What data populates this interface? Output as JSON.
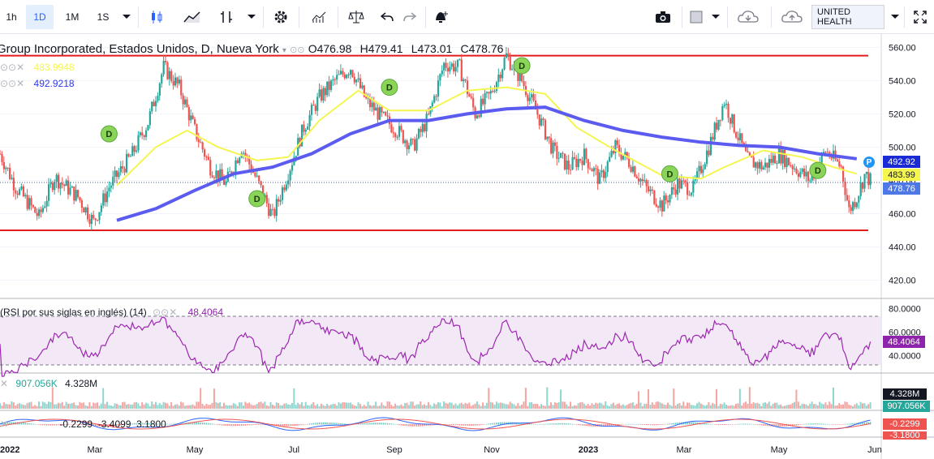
{
  "toolbar": {
    "intervals": [
      "1h",
      "1D",
      "1M",
      "1S"
    ],
    "active_interval": "1D",
    "symbol_search": "UNITED HEALTH",
    "icons": [
      "candles-icon",
      "line-chart-icon",
      "bars-icon",
      "settings-icon",
      "indicators-icon",
      "balance-icon",
      "undo-icon",
      "redo-icon",
      "alert-icon",
      "camera-icon",
      "layout-icon",
      "cloud-download-icon",
      "cloud-upload-icon",
      "fullscreen-icon"
    ]
  },
  "header": {
    "title": "Group Incorporated, Estados Unidos, D, Nueva York",
    "open": "O476.98",
    "high": "H479.41",
    "low": "L473.01",
    "close": "C478.76"
  },
  "legend": {
    "ma_slow_value": "492.9218",
    "ma_fast_value": "483.9948"
  },
  "rsi": {
    "label": "RSI por sus siglas en inglés) (14)",
    "value": "48.4064",
    "axis": [
      "80.0000",
      "60.0000",
      "40.0000"
    ],
    "badge": "48.4064"
  },
  "volume": {
    "v1": "907.056K",
    "v2": "4.328M",
    "badge_v2": "4.328M",
    "badge_v1": "907.056K"
  },
  "macd": {
    "values": "-0.2299  -3.4099  3.1800",
    "badge1": "-0.2299",
    "badge2": "-3.1800"
  },
  "price_badges": {
    "ma_slow": "492.92",
    "ma_fast": "483.99",
    "last": "478.76",
    "marker": "P"
  },
  "colors": {
    "up": "#26a69a",
    "down": "#ef5350",
    "ma_slow": "#5b5bf0",
    "ma_fast": "#f5f550",
    "hline": "#e31b1b",
    "rsi": "#9c27b0",
    "dividend": "#8bd45a"
  },
  "chart_data": {
    "type": "candlestick",
    "y_ticks": [
      560,
      540,
      520,
      500,
      480,
      460,
      440,
      420
    ],
    "ylim": [
      410,
      568
    ],
    "x_ticks": [
      "2022",
      "Mar",
      "May",
      "Jul",
      "Sep",
      "Nov",
      "2023",
      "Mar",
      "May",
      "Jun"
    ],
    "horizontal_lines": [
      555,
      450
    ],
    "dividend_marker": "D",
    "series_path": [
      {
        "t": 0,
        "p": 496
      },
      {
        "t": 4,
        "p": 476
      },
      {
        "t": 10,
        "p": 458
      },
      {
        "t": 14,
        "p": 482
      },
      {
        "t": 20,
        "p": 470
      },
      {
        "t": 24,
        "p": 455
      },
      {
        "t": 28,
        "p": 476
      },
      {
        "t": 34,
        "p": 496
      },
      {
        "t": 38,
        "p": 515
      },
      {
        "t": 42,
        "p": 548
      },
      {
        "t": 46,
        "p": 536
      },
      {
        "t": 50,
        "p": 510
      },
      {
        "t": 54,
        "p": 488
      },
      {
        "t": 58,
        "p": 478
      },
      {
        "t": 62,
        "p": 500
      },
      {
        "t": 66,
        "p": 480
      },
      {
        "t": 70,
        "p": 458
      },
      {
        "t": 74,
        "p": 485
      },
      {
        "t": 78,
        "p": 512
      },
      {
        "t": 82,
        "p": 530
      },
      {
        "t": 86,
        "p": 540
      },
      {
        "t": 90,
        "p": 548
      },
      {
        "t": 94,
        "p": 528
      },
      {
        "t": 98,
        "p": 518
      },
      {
        "t": 102,
        "p": 510
      },
      {
        "t": 106,
        "p": 500
      },
      {
        "t": 110,
        "p": 518
      },
      {
        "t": 114,
        "p": 550
      },
      {
        "t": 118,
        "p": 548
      },
      {
        "t": 122,
        "p": 520
      },
      {
        "t": 126,
        "p": 532
      },
      {
        "t": 130,
        "p": 555
      },
      {
        "t": 134,
        "p": 540
      },
      {
        "t": 138,
        "p": 520
      },
      {
        "t": 142,
        "p": 498
      },
      {
        "t": 146,
        "p": 488
      },
      {
        "t": 150,
        "p": 495
      },
      {
        "t": 154,
        "p": 480
      },
      {
        "t": 158,
        "p": 500
      },
      {
        "t": 162,
        "p": 490
      },
      {
        "t": 166,
        "p": 475
      },
      {
        "t": 170,
        "p": 465
      },
      {
        "t": 174,
        "p": 478
      },
      {
        "t": 178,
        "p": 475
      },
      {
        "t": 182,
        "p": 500
      },
      {
        "t": 186,
        "p": 528
      },
      {
        "t": 188,
        "p": 515
      },
      {
        "t": 192,
        "p": 492
      },
      {
        "t": 196,
        "p": 488
      },
      {
        "t": 200,
        "p": 496
      },
      {
        "t": 204,
        "p": 488
      },
      {
        "t": 208,
        "p": 480
      },
      {
        "t": 212,
        "p": 498
      },
      {
        "t": 216,
        "p": 488
      },
      {
        "t": 218,
        "p": 462
      },
      {
        "t": 220,
        "p": 470
      },
      {
        "t": 222,
        "p": 483
      },
      {
        "t": 224,
        "p": 479
      }
    ],
    "ma_slow": [
      {
        "t": 30,
        "p": 456
      },
      {
        "t": 40,
        "p": 463
      },
      {
        "t": 50,
        "p": 474
      },
      {
        "t": 60,
        "p": 484
      },
      {
        "t": 70,
        "p": 488
      },
      {
        "t": 80,
        "p": 496
      },
      {
        "t": 90,
        "p": 508
      },
      {
        "t": 100,
        "p": 516
      },
      {
        "t": 110,
        "p": 516
      },
      {
        "t": 120,
        "p": 520
      },
      {
        "t": 130,
        "p": 523
      },
      {
        "t": 140,
        "p": 524
      },
      {
        "t": 150,
        "p": 516
      },
      {
        "t": 160,
        "p": 510
      },
      {
        "t": 170,
        "p": 506
      },
      {
        "t": 180,
        "p": 503
      },
      {
        "t": 190,
        "p": 501
      },
      {
        "t": 200,
        "p": 500
      },
      {
        "t": 210,
        "p": 496
      },
      {
        "t": 220,
        "p": 493
      }
    ],
    "ma_fast": [
      {
        "t": 30,
        "p": 477
      },
      {
        "t": 40,
        "p": 500
      },
      {
        "t": 48,
        "p": 510
      },
      {
        "t": 56,
        "p": 500
      },
      {
        "t": 66,
        "p": 492
      },
      {
        "t": 74,
        "p": 494
      },
      {
        "t": 82,
        "p": 516
      },
      {
        "t": 92,
        "p": 534
      },
      {
        "t": 100,
        "p": 522
      },
      {
        "t": 110,
        "p": 522
      },
      {
        "t": 120,
        "p": 534
      },
      {
        "t": 130,
        "p": 536
      },
      {
        "t": 140,
        "p": 532
      },
      {
        "t": 148,
        "p": 512
      },
      {
        "t": 158,
        "p": 498
      },
      {
        "t": 170,
        "p": 483
      },
      {
        "t": 180,
        "p": 481
      },
      {
        "t": 186,
        "p": 488
      },
      {
        "t": 196,
        "p": 498
      },
      {
        "t": 206,
        "p": 494
      },
      {
        "t": 214,
        "p": 488
      },
      {
        "t": 220,
        "p": 484
      }
    ],
    "dividends": [
      {
        "t": 28,
        "p": 508
      },
      {
        "t": 66,
        "p": 469
      },
      {
        "t": 100,
        "p": 536
      },
      {
        "t": 134,
        "p": 549
      },
      {
        "t": 172,
        "p": 484
      },
      {
        "t": 210,
        "p": 486
      }
    ]
  }
}
